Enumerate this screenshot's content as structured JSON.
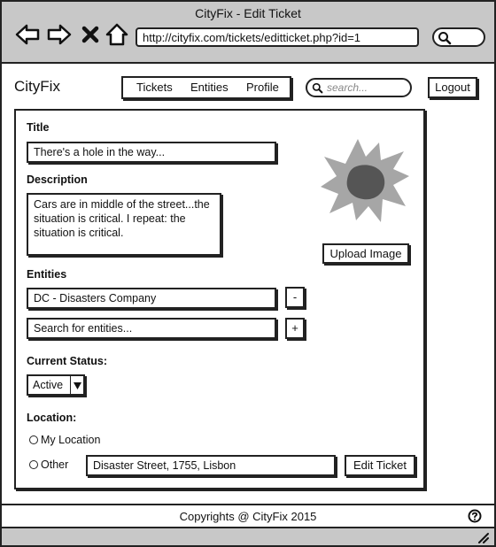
{
  "window": {
    "title": "CityFix - Edit Ticket"
  },
  "browser": {
    "url": "http://cityfix.com/tickets/editticket.php?id=1"
  },
  "header": {
    "logo": "CityFix",
    "nav": [
      "Tickets",
      "Entities",
      "Profile"
    ],
    "search_placeholder": "search...",
    "logout_label": "Logout"
  },
  "form": {
    "title_label": "Title",
    "title_value": "There's a hole in the way...",
    "description_label": "Description",
    "description_value": "Cars are in middle of the street...the situation is critical. I repeat: the situation is critical.",
    "upload_label": "Upload Image",
    "entities_label": "Entities",
    "entity_value": "DC - Disasters Company",
    "entity_remove": "-",
    "entity_search_placeholder": "Search for entities...",
    "entity_add": "+",
    "status_label": "Current Status:",
    "status_value": "Active",
    "location_label": "Location:",
    "option_my_location": "My Location",
    "option_other": "Other",
    "location_value": "Disaster Street, 1755, Lisbon",
    "edit_button": "Edit Ticket"
  },
  "footer": {
    "text": "Copyrights @ CityFix 2015"
  },
  "colors": {
    "chrome": "#c8c8c8",
    "image_fill": "#a6a6a6",
    "image_hole": "#555555"
  }
}
